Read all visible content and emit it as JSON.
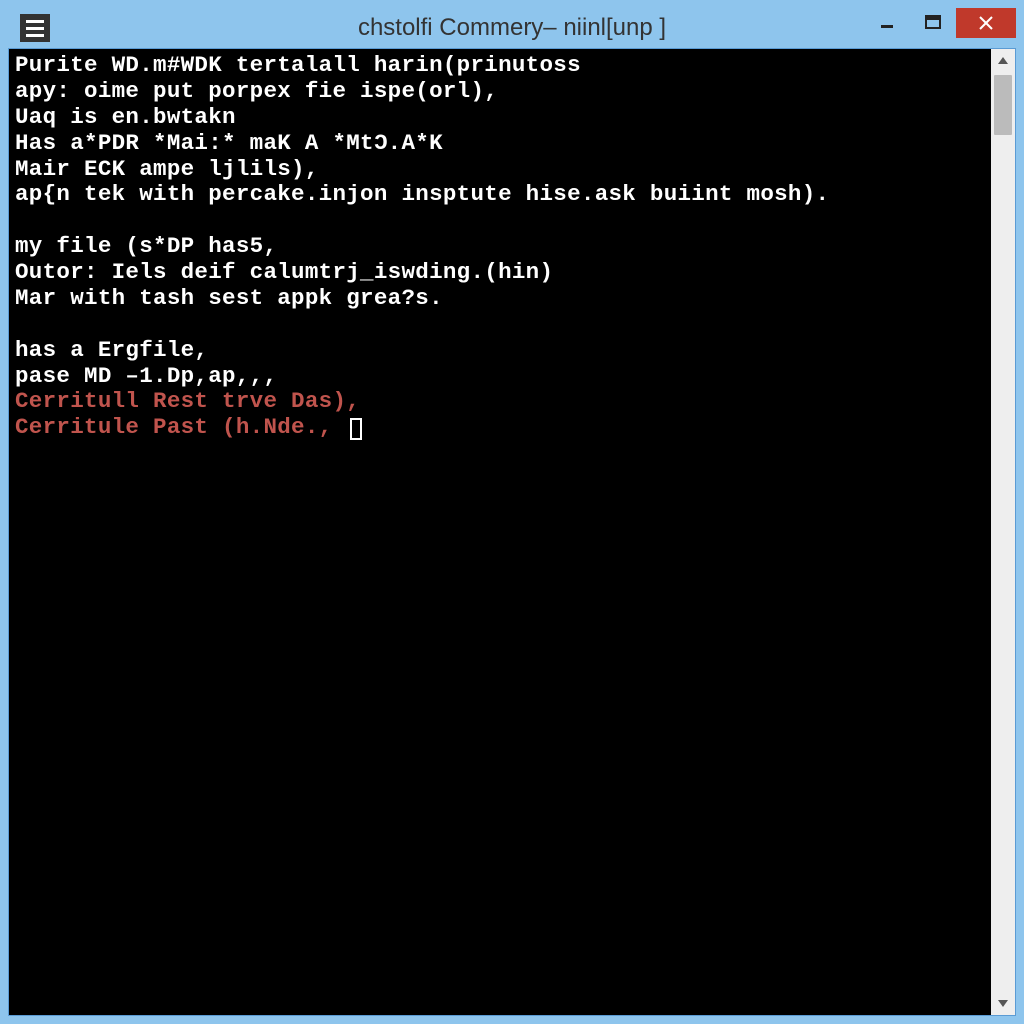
{
  "window": {
    "title": "chstolfi Commery– niinl[unp ]"
  },
  "terminal": {
    "lines": [
      {
        "text": "Purite WD.m#WDK tertalall harin(prinutoss",
        "color": "white"
      },
      {
        "text": "apy: oime put porpex fie ispe(orl),",
        "color": "white"
      },
      {
        "text": "Uaq is en.bwtakn",
        "color": "white"
      },
      {
        "text": "Has a*PDR *Mai:* maK A *MtƆ.A*K",
        "color": "white"
      },
      {
        "text": "Mair ECK ampe ljlils),",
        "color": "white"
      },
      {
        "text": "ap{n tek with percake.injon insptute hise.ask buiint mosh).",
        "color": "white"
      },
      {
        "text": "",
        "color": "white"
      },
      {
        "text": "my file (s*DP has5,",
        "color": "white"
      },
      {
        "text": "Outor: Iels deif calumtrj_iswding.(hin)",
        "color": "white"
      },
      {
        "text": "Mar with tash sest appk grea?s.",
        "color": "white"
      },
      {
        "text": "",
        "color": "white"
      },
      {
        "text": "has a Ergfile,",
        "color": "white"
      },
      {
        "text": "pase MD –1.Dp,ap,,,",
        "color": "white"
      },
      {
        "text": "Cerritull Rest trve Das),",
        "color": "red"
      },
      {
        "text": "Cerritule Past (h.Nde., ",
        "color": "red",
        "cursor": true
      }
    ]
  }
}
